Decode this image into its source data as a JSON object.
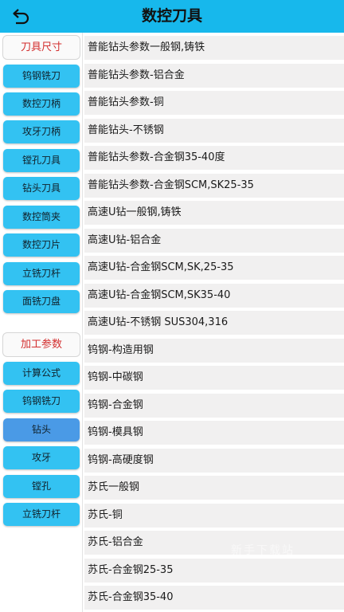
{
  "header": {
    "title": "数控刀具"
  },
  "sidebar": {
    "section1_title": "刀具尺寸",
    "section1_items": [
      "钨钢铣刀",
      "数控刀柄",
      "攻牙刀柄",
      "镗孔刀具",
      "钻头刀具",
      "数控筒夹",
      "数控刀片",
      "立铣刀杆",
      "面铣刀盘"
    ],
    "section2_title": "加工参数",
    "section2_items": [
      "计算公式",
      "钨钢铣刀",
      "钻头",
      "攻牙",
      "镗孔",
      "立铣刀杆"
    ],
    "selected": "钻头"
  },
  "list": {
    "items": [
      "普能钻头参数一般钢,铸铁",
      "普能钻头参数-铝合金",
      "普能钻头参数-铜",
      "普能钻头-不锈钢",
      "普能钻头参数-合金钢35-40度",
      "普能钻头参数-合金钢SCM,SK25-35",
      "高速U钻一般钢,铸铁",
      "高速U钻-铝合金",
      "高速U钻-合金钢SCM,SK,25-35",
      "高速U钻-合金钢SCM,SK35-40",
      "高速U钻-不锈钢 SUS304,316",
      "钨钢-构造用钢",
      "钨钢-中碳钢",
      "钨钢-合金钢",
      "钨钢-模具钢",
      "钨钢-高硬度钢",
      "苏氏一般钢",
      "苏氏-铜",
      "苏氏-铝合金",
      "苏氏-合金钢25-35",
      "苏氏-合金钢35-40"
    ]
  },
  "watermark": "新手下载站",
  "colors": {
    "header": "#17b8ec",
    "button": "#33c2f2",
    "button_selected": "#4a9ae6",
    "section_text": "#d32f2f",
    "list_bg": "#f1f0f0"
  }
}
